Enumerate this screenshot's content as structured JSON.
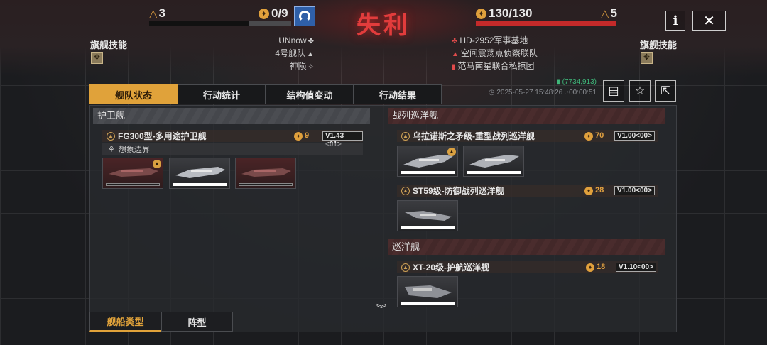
{
  "header": {
    "result": "失利",
    "left": {
      "count": "3",
      "licenses": "0/9"
    },
    "right": {
      "hp": "130/130",
      "count": "5"
    },
    "colors": {
      "accent": "#e0a23a",
      "defeat": "#e23c3c",
      "hp_bar": "#c42a2a"
    }
  },
  "left_fleet": {
    "skill_label": "旗舰技能",
    "lines": [
      "UNnow",
      "4号舰队",
      "神陨"
    ]
  },
  "right_fleet": {
    "skill_label": "旗舰技能",
    "lines": [
      "HD-2952军事基地",
      "空间震荡点侦察联队",
      "范马南星联合私掠团"
    ]
  },
  "top_buttons": {
    "info": "i",
    "close": "✕"
  },
  "tabs": [
    "舰队状态",
    "行动统计",
    "结构值变动",
    "行动结果"
  ],
  "meta": {
    "coord": "(7734,913)",
    "datetime": "2025-05-27 15:48:26",
    "duration": "00:00:51"
  },
  "sections": {
    "frigate": {
      "title": "护卫舰",
      "ship": {
        "name": "FG300型-多用途护卫舰",
        "cost": "9",
        "version": "V1.43 <01>",
        "sub": "想象边界"
      }
    },
    "battlecruiser": {
      "title": "战列巡洋舰",
      "ships": [
        {
          "name": "乌拉诺斯之矛级-重型战列巡洋舰",
          "cost": "70",
          "version": "V1.00<00>"
        },
        {
          "name": "ST59级-防御战列巡洋舰",
          "cost": "28",
          "version": "V1.00<00>"
        }
      ]
    },
    "cruiser": {
      "title": "巡洋舰",
      "ship": {
        "name": "XT-20级-护航巡洋舰",
        "cost": "18",
        "version": "V1.10<00>"
      }
    }
  },
  "bottom_tabs": [
    "舰船类型",
    "阵型"
  ]
}
